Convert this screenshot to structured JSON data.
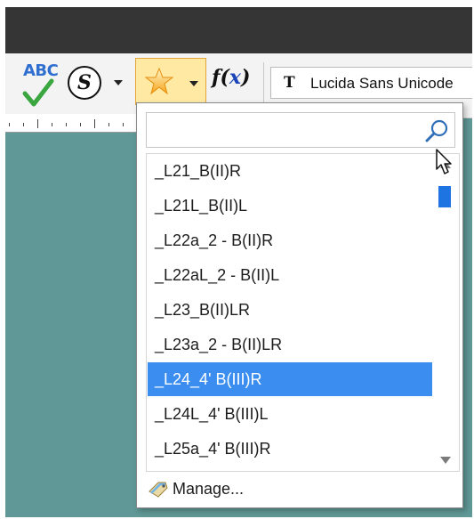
{
  "toolbar": {
    "spell_check": {
      "text": "ABC"
    },
    "styles_button": {
      "text": "S"
    },
    "favorites_button": {
      "icon": "star-icon",
      "accent": "#ffe9a3"
    },
    "function_button": {
      "prefix": "f(",
      "var": "x",
      "suffix": ")"
    },
    "font_selector": {
      "value": "Lucida Sans Unicode",
      "icon_text": "T"
    }
  },
  "dropdown": {
    "search": {
      "value": "",
      "placeholder": ""
    },
    "items": [
      {
        "label": "_L21_B(II)R",
        "selected": false
      },
      {
        "label": "_L21L_B(II)L",
        "selected": false
      },
      {
        "label": "_L22a_2 - B(II)R",
        "selected": false
      },
      {
        "label": "_L22aL_2 - B(II)L",
        "selected": false
      },
      {
        "label": "_L23_B(II)LR",
        "selected": false
      },
      {
        "label": "_L23a_2 - B(II)LR",
        "selected": false
      },
      {
        "label": "_L24_4' B(III)R",
        "selected": true
      },
      {
        "label": "_L24L_4' B(III)L",
        "selected": false
      },
      {
        "label": "_L25a_4' B(III)R",
        "selected": false
      }
    ],
    "manage_label": "Manage..."
  },
  "colors": {
    "background": "#5f9896",
    "title_bar": "#353535",
    "selection": "#3b8ef0",
    "scroll_thumb": "#1e74e0"
  }
}
